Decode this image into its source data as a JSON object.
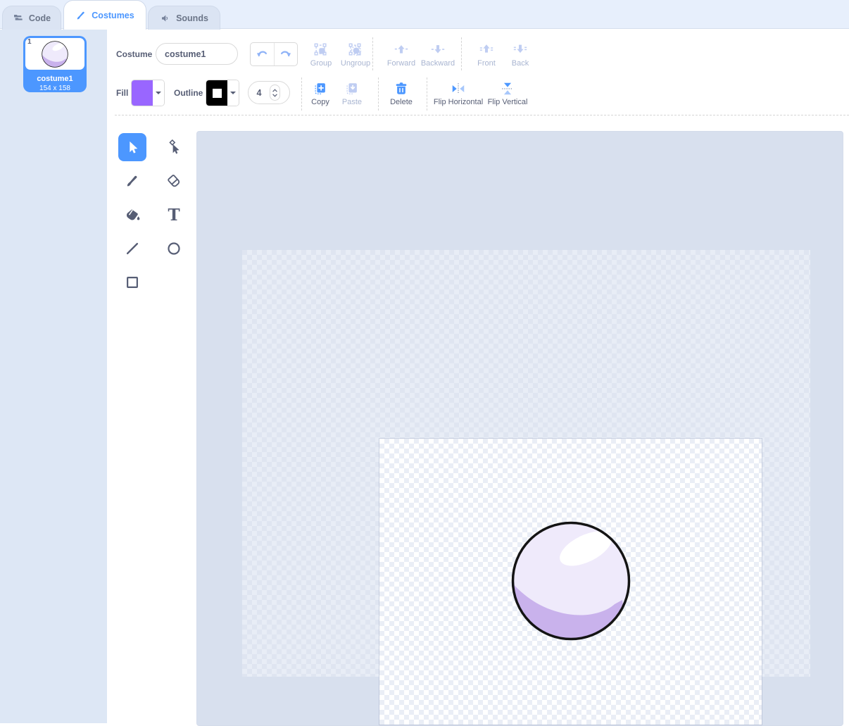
{
  "tabs": {
    "code": "Code",
    "costumes": "Costumes",
    "sounds": "Sounds",
    "active": "costumes"
  },
  "costume_list": {
    "items": [
      {
        "index": "1",
        "name": "costume1",
        "size": "154 x 158",
        "selected": true
      }
    ]
  },
  "toolbar": {
    "costume_label": "Costume",
    "costume_name_value": "costume1",
    "group_label": "Group",
    "ungroup_label": "Ungroup",
    "forward_label": "Forward",
    "backward_label": "Backward",
    "front_label": "Front",
    "back_label": "Back",
    "fill_label": "Fill",
    "outline_label": "Outline",
    "stroke_width_value": "4",
    "copy_label": "Copy",
    "paste_label": "Paste",
    "delete_label": "Delete",
    "flip_horizontal_label": "Flip Horizontal",
    "flip_vertical_label": "Flip Vertical",
    "disabled_buttons": [
      "group",
      "ungroup",
      "forward",
      "backward",
      "front",
      "back",
      "paste",
      "undo",
      "redo"
    ]
  },
  "tools": {
    "active": "select",
    "items": [
      "select",
      "reshape",
      "brush",
      "eraser",
      "fill",
      "text",
      "line",
      "circle",
      "rectangle"
    ]
  },
  "colors": {
    "accent": "#4C97FF",
    "fill_swatch": "#9966FF",
    "outline_swatch": "#000000",
    "ball_body": "#EFEAFB",
    "ball_shade": "#C9B2EC",
    "ball_highlight": "#FFFFFF",
    "ball_outline": "#141414"
  }
}
